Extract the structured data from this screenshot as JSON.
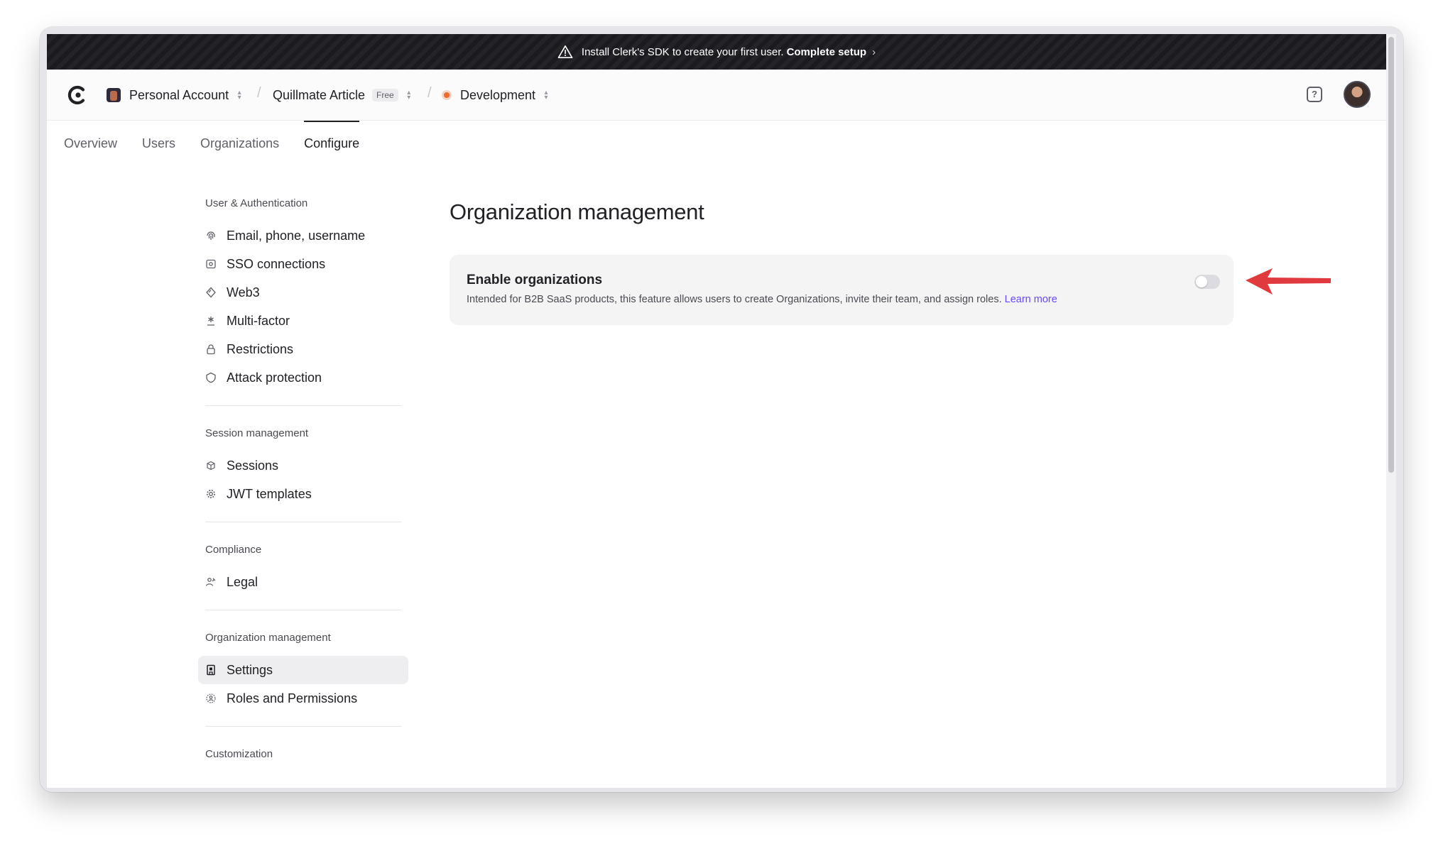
{
  "banner": {
    "text": "Install Clerk's SDK to create your first user.",
    "cta": "Complete setup",
    "chevron": "›",
    "icon": "warning-triangle-icon"
  },
  "topbar": {
    "account": "Personal Account",
    "app": "Quillmate Article",
    "plan_badge": "Free",
    "environment": "Development",
    "separator": "/",
    "help_glyph": "?",
    "environment_dot_color": "#f06a2c"
  },
  "tabs": [
    {
      "label": "Overview"
    },
    {
      "label": "Users"
    },
    {
      "label": "Organizations"
    },
    {
      "label": "Configure",
      "active": true
    }
  ],
  "sidebar": {
    "sections": [
      {
        "title": "User & Authentication",
        "items": [
          {
            "label": "Email, phone, username",
            "icon": "fingerprint-icon"
          },
          {
            "label": "SSO connections",
            "icon": "sso-icon"
          },
          {
            "label": "Web3",
            "icon": "web3-diamond-icon"
          },
          {
            "label": "Multi-factor",
            "icon": "asterisk-icon"
          },
          {
            "label": "Restrictions",
            "icon": "lock-icon"
          },
          {
            "label": "Attack protection",
            "icon": "shield-icon"
          }
        ]
      },
      {
        "title": "Session management",
        "items": [
          {
            "label": "Sessions",
            "icon": "sessions-icon"
          },
          {
            "label": "JWT templates",
            "icon": "gear-icon"
          }
        ]
      },
      {
        "title": "Compliance",
        "items": [
          {
            "label": "Legal",
            "icon": "legal-icon"
          }
        ]
      },
      {
        "title": "Organization management",
        "items": [
          {
            "label": "Settings",
            "icon": "building-icon",
            "active": true
          },
          {
            "label": "Roles and Permissions",
            "icon": "roles-icon"
          }
        ]
      },
      {
        "title": "Customization",
        "items": []
      }
    ]
  },
  "main": {
    "title": "Organization management",
    "card": {
      "title": "Enable organizations",
      "description": "Intended for B2B SaaS products, this feature allows users to create Organizations, invite their team, and assign roles.",
      "link": "Learn more",
      "toggle_on": false
    }
  },
  "colors": {
    "accent_link": "#6c47ff",
    "annotation_arrow": "#e0393e"
  }
}
